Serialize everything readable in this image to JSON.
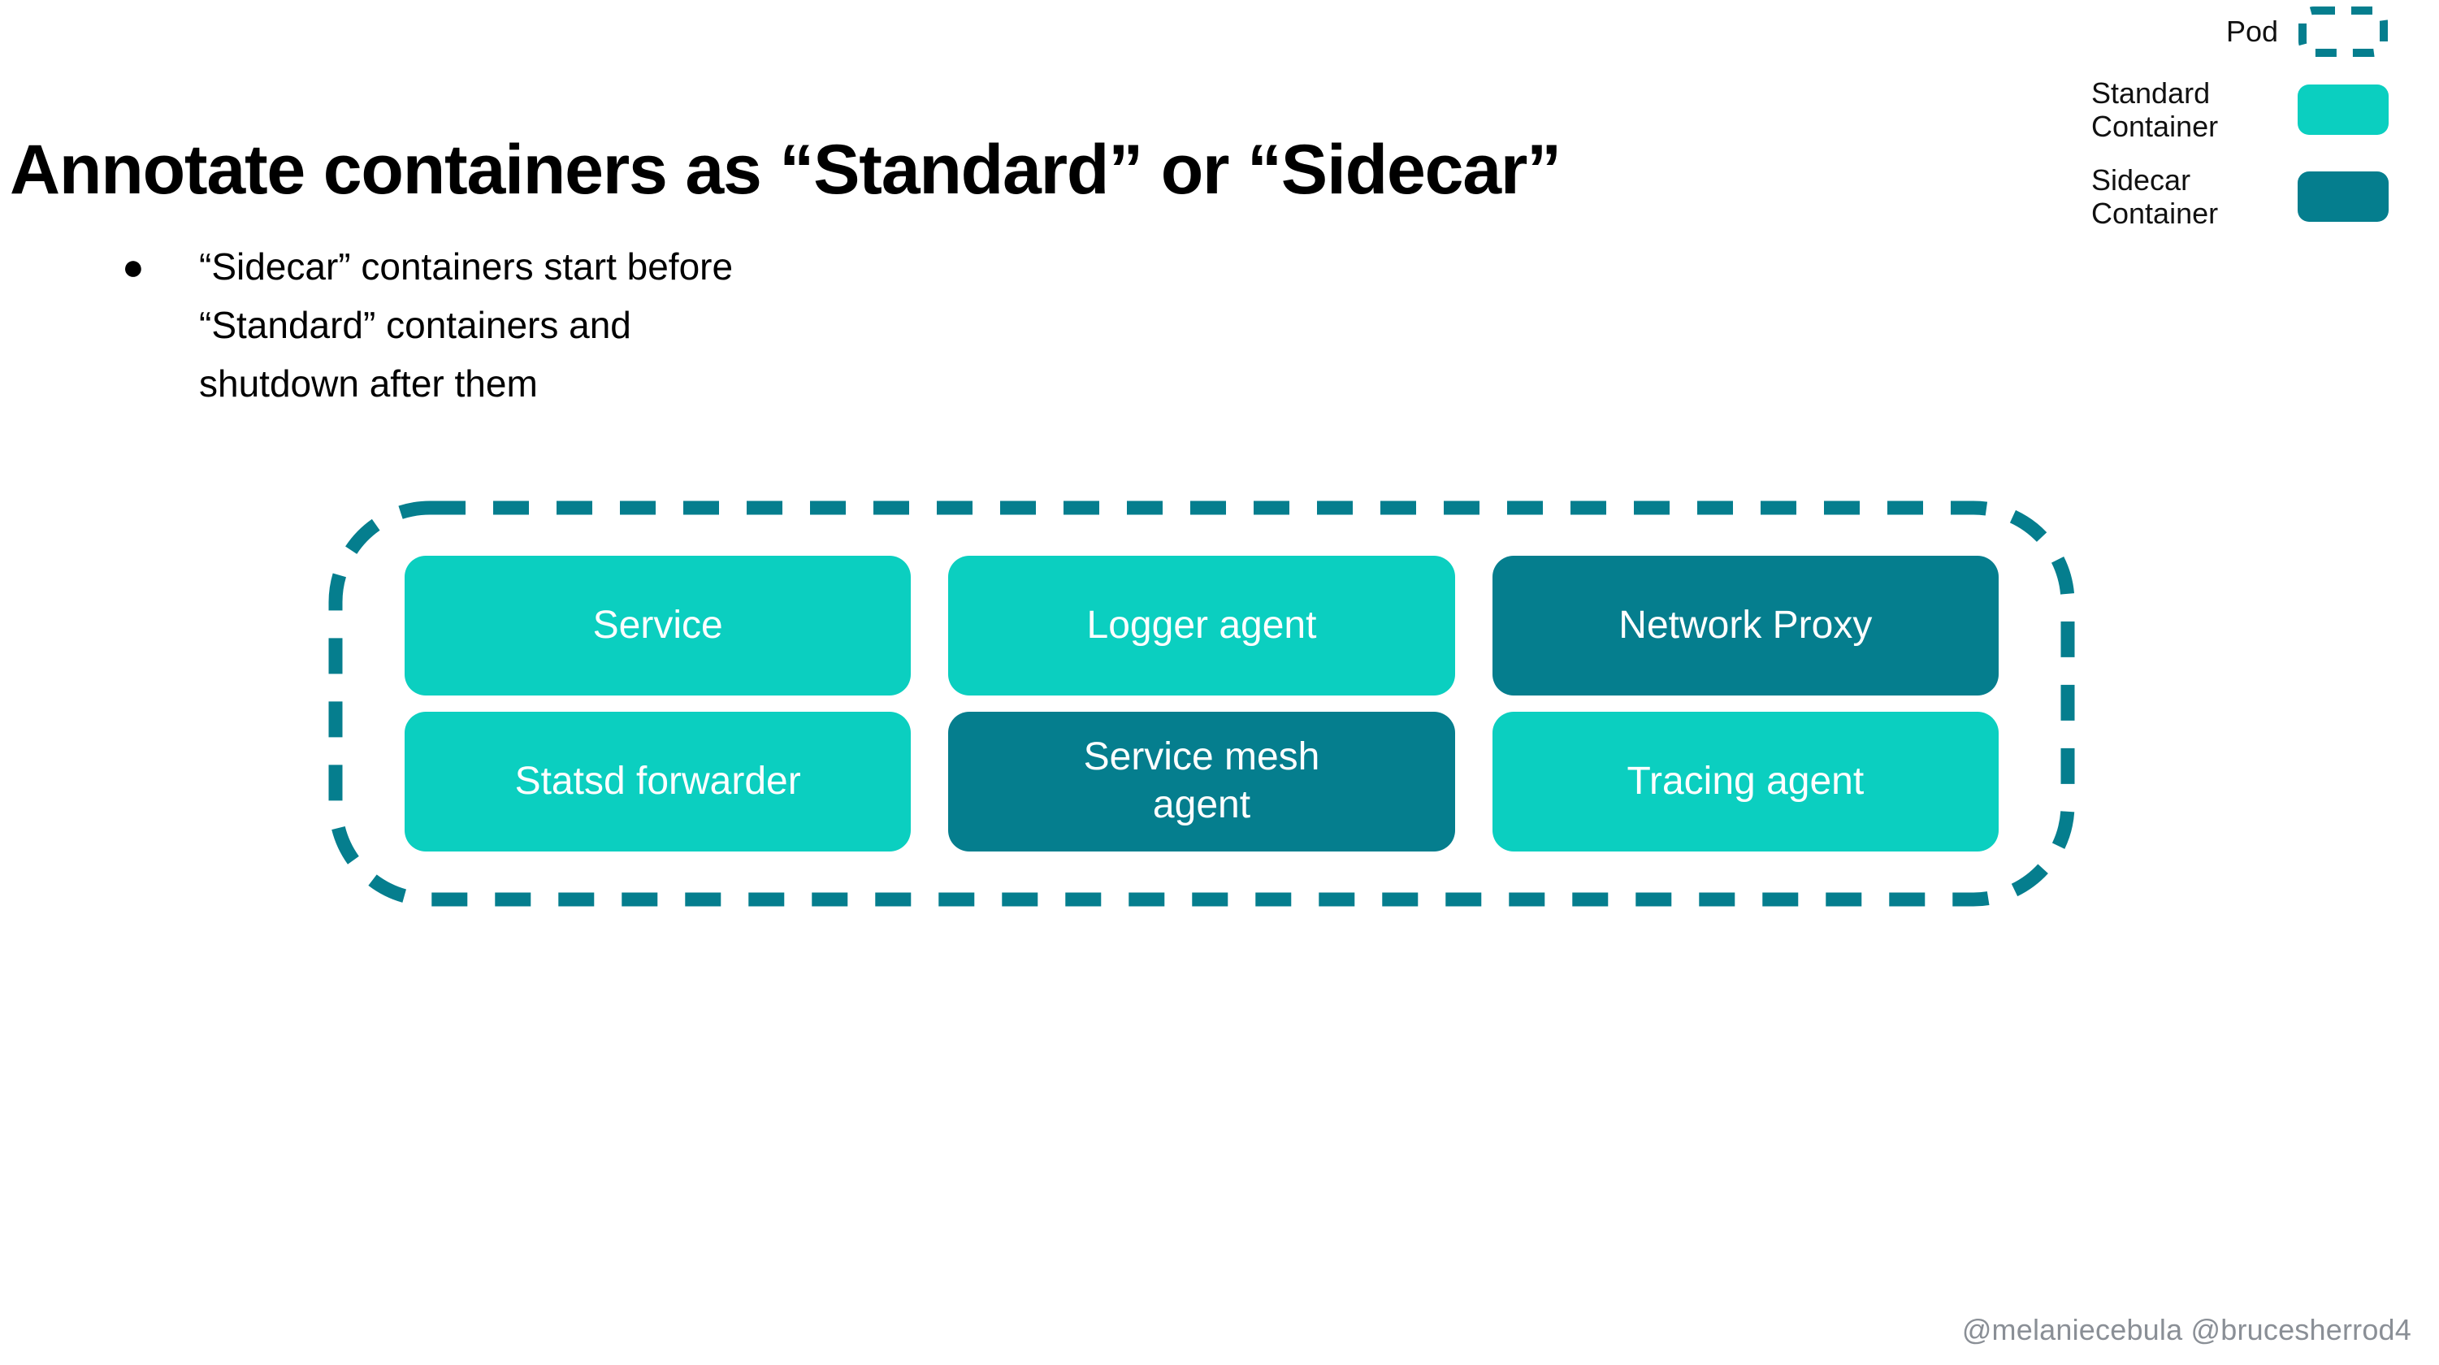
{
  "slide": {
    "title": "Annotate containers as “Standard” or “Sidecar”",
    "background_color": "#ffffff"
  },
  "bullets": [
    {
      "marker": "●",
      "lines": [
        "“Sidecar” containers start before",
        "“Standard” containers and",
        "shutdown after them"
      ]
    }
  ],
  "legend": {
    "items": [
      {
        "label_lines": [
          "Pod"
        ],
        "swatch_type": "dashed-outline",
        "color": "#057E8E"
      },
      {
        "label_lines": [
          "Standard",
          "Container"
        ],
        "swatch_type": "filled",
        "color": "#0BCFC0"
      },
      {
        "label_lines": [
          "Sidecar",
          "Container"
        ],
        "swatch_type": "filled",
        "color": "#057E8E"
      }
    ]
  },
  "pod_diagram": {
    "pod_border_color": "#057E8E",
    "containers": [
      {
        "lines": [
          "Service"
        ],
        "kind": "standard"
      },
      {
        "lines": [
          "Logger agent"
        ],
        "kind": "standard"
      },
      {
        "lines": [
          "Network Proxy"
        ],
        "kind": "sidecar"
      },
      {
        "lines": [
          "Statsd forwarder"
        ],
        "kind": "standard"
      },
      {
        "lines": [
          "Service mesh",
          "agent"
        ],
        "kind": "sidecar"
      },
      {
        "lines": [
          "Tracing agent"
        ],
        "kind": "standard"
      }
    ]
  },
  "footer": {
    "handles": "@melaniecebula @brucesherrod4"
  },
  "colors": {
    "standard_container": "#0BCFC0",
    "sidecar_container": "#057E8E",
    "pod_outline": "#057E8E",
    "title_text": "#000000",
    "footer_text": "#8a8f96"
  }
}
